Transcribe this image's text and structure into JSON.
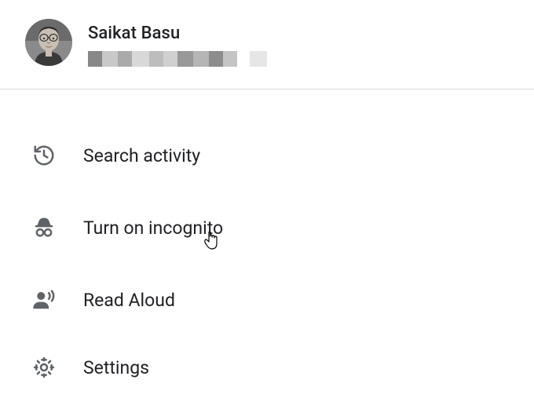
{
  "profile": {
    "name": "Saikat Basu"
  },
  "menu": {
    "search_activity": "Search activity",
    "incognito": "Turn on incognito",
    "read_aloud": "Read Aloud",
    "settings": "Settings"
  }
}
